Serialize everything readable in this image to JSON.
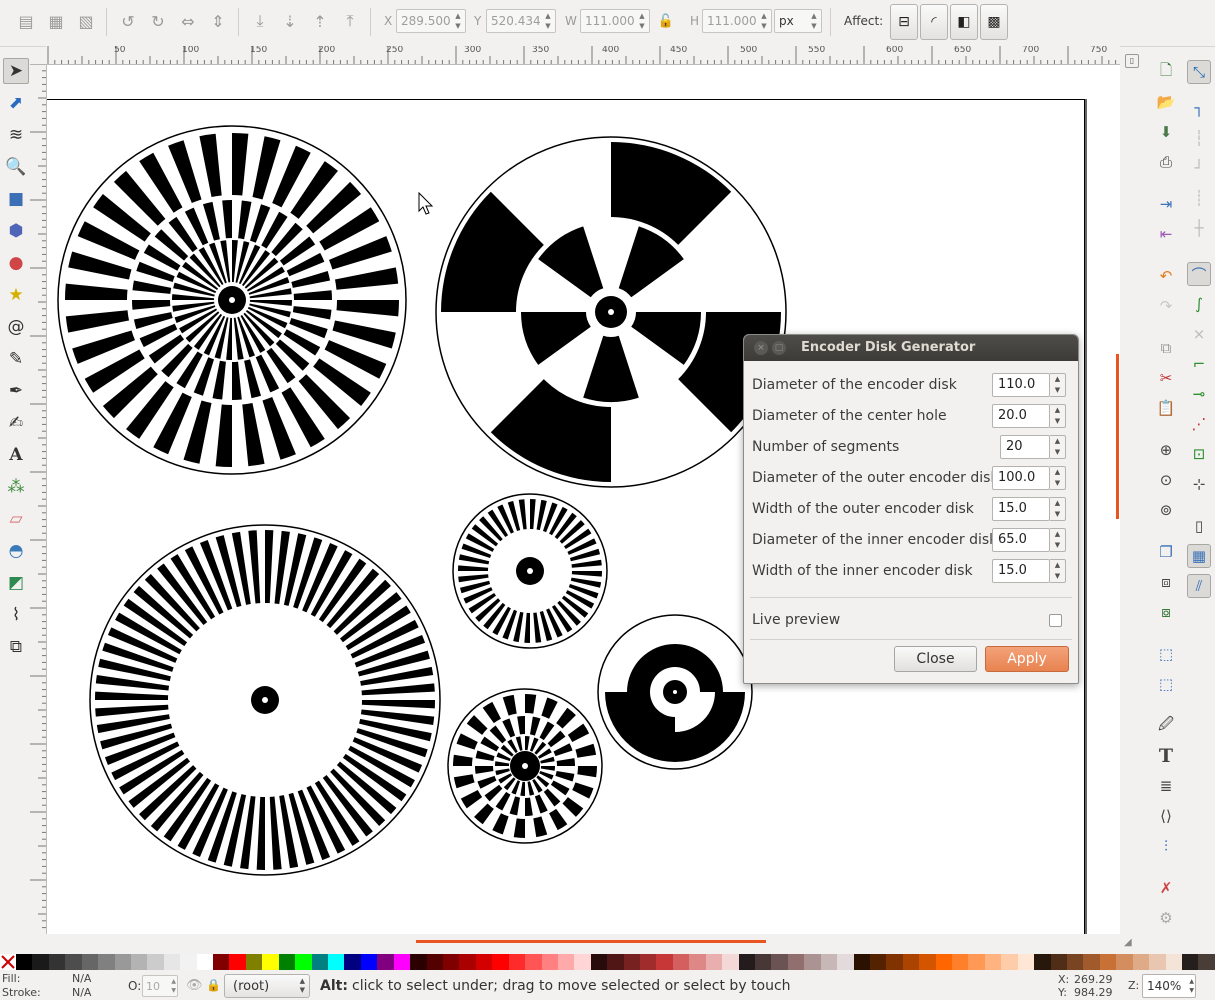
{
  "toolbar": {
    "x_label": "X",
    "x_value": "289.500",
    "y_label": "Y",
    "y_value": "520.434",
    "w_label": "W",
    "w_value": "111.000",
    "h_label": "H",
    "h_value": "111.000",
    "unit": "px",
    "affect_label": "Affect:"
  },
  "hruler_ticks": [
    "50",
    "100",
    "150",
    "200",
    "250",
    "300",
    "350",
    "400",
    "450",
    "500",
    "550",
    "600",
    "650",
    "700",
    "750"
  ],
  "vruler_ticks": [
    "50",
    "100",
    "150",
    "200",
    "250",
    "300",
    "350",
    "400",
    "450",
    "500",
    "550",
    "600",
    "650",
    "700",
    "750",
    "800",
    "850"
  ],
  "dialog": {
    "title": "Encoder Disk Generator",
    "params": [
      {
        "label": "Diameter of the encoder disk",
        "value": "110.0"
      },
      {
        "label": "Diameter of the center hole",
        "value": "20.0"
      },
      {
        "label": "Number of segments",
        "value": "20"
      },
      {
        "label": "Diameter of the outer encoder disk",
        "value": "100.0"
      },
      {
        "label": "Width of the outer encoder disk",
        "value": "15.0"
      },
      {
        "label": "Diameter of the inner encoder disk",
        "value": "65.0"
      },
      {
        "label": "Width of the inner encoder disk",
        "value": "15.0"
      }
    ],
    "live_preview_label": "Live preview",
    "live_preview_checked": false,
    "close_label": "Close",
    "apply_label": "Apply"
  },
  "status": {
    "fill_label": "Fill:",
    "fill_value": "N/A",
    "stroke_label": "Stroke:",
    "stroke_value": "N/A",
    "opacity_label": "O:",
    "opacity_value": "10",
    "layer": "(root)",
    "message_key": "Alt:",
    "message": "click to select under; drag to move selected or select by touch",
    "cursor_x_label": "X:",
    "cursor_x": "269.29",
    "cursor_y_label": "Y:",
    "cursor_y": "984.29",
    "zoom_label": "Z:",
    "zoom": "140%"
  },
  "colors": {
    "accent": "#e95420",
    "apply_button": "#ed8655",
    "dialog_title_bg": "#3c3b37"
  },
  "palette": [
    "#000000",
    "#1a1a1a",
    "#333333",
    "#4d4d4d",
    "#666666",
    "#808080",
    "#999999",
    "#b3b3b3",
    "#cccccc",
    "#e6e6e6",
    "#f2f2f2",
    "#ffffff",
    "#800000",
    "#ff0000",
    "#808000",
    "#ffff00",
    "#008000",
    "#00ff00",
    "#008080",
    "#00ffff",
    "#000080",
    "#0000ff",
    "#800080",
    "#ff00ff",
    "#2b0000",
    "#550000",
    "#800000",
    "#aa0000",
    "#d40000",
    "#ff0000",
    "#ff2a2a",
    "#ff5555",
    "#ff8080",
    "#ffaaaa",
    "#ffd5d5",
    "#280b0b",
    "#501616",
    "#782121",
    "#a02c2c",
    "#c83737",
    "#d35f5f",
    "#de8787",
    "#e9afaf",
    "#f4d7d7",
    "#241c1c",
    "#483737",
    "#6c5353",
    "#916f6f",
    "#ac9393",
    "#c8b7b7",
    "#e3dbdb",
    "#2b1100",
    "#552200",
    "#803300",
    "#aa4400",
    "#d45500",
    "#ff6600",
    "#ff7f2a",
    "#ff9955",
    "#ffb380",
    "#ffccaa",
    "#ffe6d5",
    "#28170b",
    "#502d16",
    "#784421",
    "#a05a2c",
    "#c87137",
    "#d38d5f",
    "#deaa87",
    "#e9c6af",
    "#f4e3d7",
    "#241f1c",
    "#483e37"
  ]
}
